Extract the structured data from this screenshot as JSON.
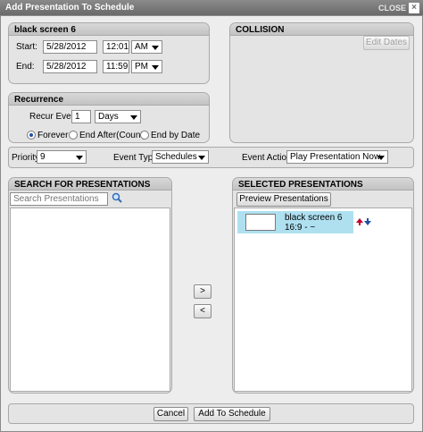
{
  "window": {
    "title": "Add Presentation To Schedule",
    "close_label": "CLOSE",
    "close_glyph": "×"
  },
  "schedule": {
    "heading": "black screen 6",
    "start_label": "Start:",
    "start_date": "5/28/2012",
    "start_time": "12:01",
    "start_ampm": "AM",
    "end_label": "End:",
    "end_date": "5/28/2012",
    "end_time": "11:59",
    "end_ampm": "PM"
  },
  "collision": {
    "heading": "COLLISION",
    "edit_dates_label": "Edit Dates"
  },
  "recurrence": {
    "heading": "Recurrence",
    "recur_every_label": "Recur Every",
    "recur_every_value": "1",
    "unit": "Days",
    "options": [
      "Forever",
      "End After(Count)",
      "End by Date"
    ],
    "selected": "Forever"
  },
  "options_bar": {
    "priority_label": "Priority:",
    "priority_value": "9",
    "event_type_label": "Event Type:",
    "event_type_value": "Schedules",
    "event_action_label": "Event Action:",
    "event_action_value": "Play Presentation Now"
  },
  "search": {
    "heading": "SEARCH FOR PRESENTATIONS",
    "placeholder": "Search Presentations",
    "search_icon": "magnifier-icon"
  },
  "transfer": {
    "add_label": ">",
    "remove_label": "<"
  },
  "selected": {
    "heading": "SELECTED PRESENTATIONS",
    "preview_label": "Preview Presentations",
    "items": [
      {
        "name": "black screen 6",
        "aspect": "16:9 - ~"
      }
    ],
    "move_up_icon": "arrow-up-icon",
    "move_down_icon": "arrow-down-icon",
    "up_color": "#c00030",
    "down_color": "#1f4fa8",
    "highlight_color": "#aee0f0"
  },
  "footer": {
    "cancel_label": "Cancel",
    "submit_label": "Add To Schedule"
  }
}
